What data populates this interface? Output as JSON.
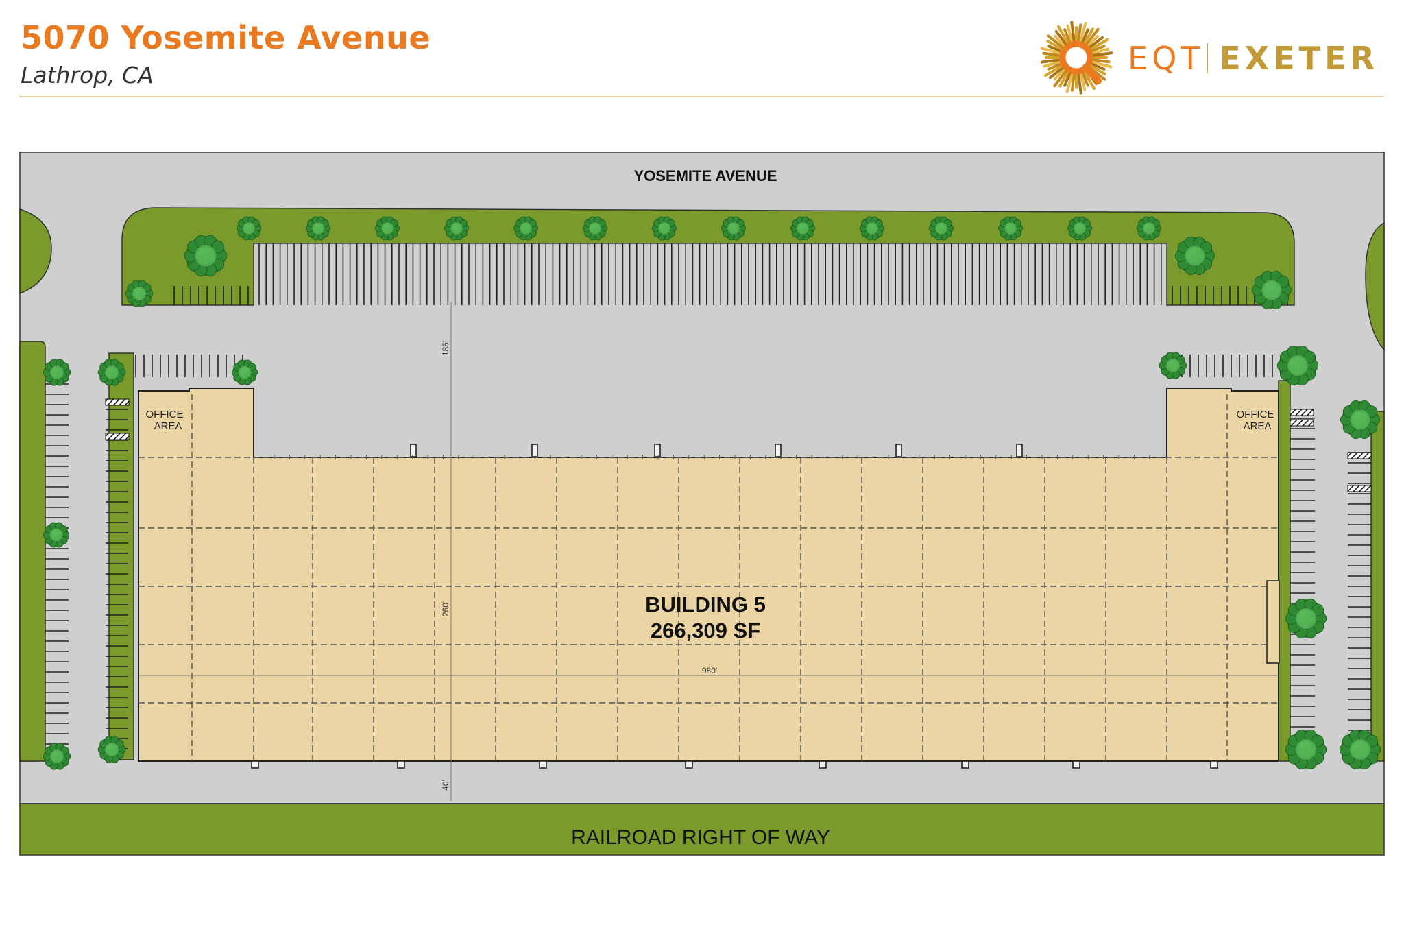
{
  "header": {
    "title": "5070 Yosemite Avenue",
    "subtitle": "Lathrop, CA"
  },
  "logo": {
    "icon": "sunburst-magnifier-icon",
    "brand_left": "EQT",
    "brand_right": "EXETER"
  },
  "site_plan": {
    "street_label": "YOSEMITE AVENUE",
    "building_name": "BUILDING 5",
    "building_area": "266,309 SF",
    "office_left": [
      "OFFICE",
      "AREA"
    ],
    "office_right": [
      "OFFICE",
      "AREA"
    ],
    "dim_setback_north": "185'",
    "dim_depth": "260'",
    "dim_length": "980'",
    "dim_setback_south": "40'",
    "rail_label": "RAILROAD RIGHT OF WAY"
  },
  "colors": {
    "title_orange": "#ea7a1f",
    "landscape_green": "#7a9a2b",
    "pavement_gray": "#cfcfcf",
    "building_tan": "#ebd5a4",
    "brand_gold": "#c29b38"
  }
}
